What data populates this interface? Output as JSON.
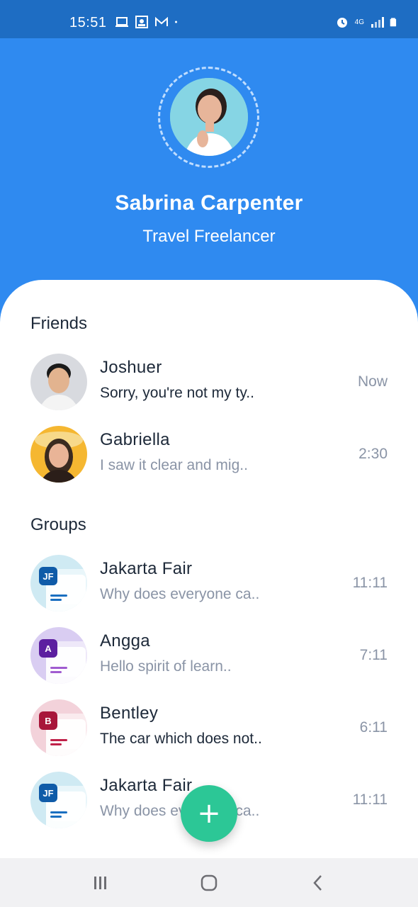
{
  "status_bar": {
    "time": "15:51",
    "network": "4G"
  },
  "profile": {
    "name": "Sabrina Carpenter",
    "role": "Travel Freelancer"
  },
  "sections": {
    "friends_title": "Friends",
    "groups_title": "Groups"
  },
  "friends": [
    {
      "name": "Joshuer",
      "message": "Sorry, you're not my ty..",
      "time": "Now"
    },
    {
      "name": "Gabriella",
      "message": "I saw it clear and mig..",
      "time": "2:30"
    }
  ],
  "groups": [
    {
      "name": "Jakarta Fair",
      "initials": "JF",
      "message": "Why does everyone ca..",
      "time": "11:11",
      "color": "#0F5BA8",
      "bg": "#CFEAF3",
      "line": "#1A6FC0"
    },
    {
      "name": "Angga",
      "initials": "A",
      "message": "Hello spirit of learn..",
      "time": "7:11",
      "color": "#5C1FA0",
      "bg": "#D9CDF2",
      "line": "#A05BD0"
    },
    {
      "name": "Bentley",
      "initials": "B",
      "message": "The car which does not..",
      "time": "6:11",
      "color": "#A8163A",
      "bg": "#F3D2DA",
      "line": "#C02149"
    },
    {
      "name": "Jakarta Fair",
      "initials": "JF",
      "message": "Why does everyone ca..",
      "time": "11:11",
      "color": "#0F5BA8",
      "bg": "#CFEAF3",
      "line": "#1A6FC0"
    }
  ],
  "fab": {
    "label": "+"
  },
  "colors": {
    "primary": "#2F8AF0",
    "accent": "#2CC796"
  }
}
